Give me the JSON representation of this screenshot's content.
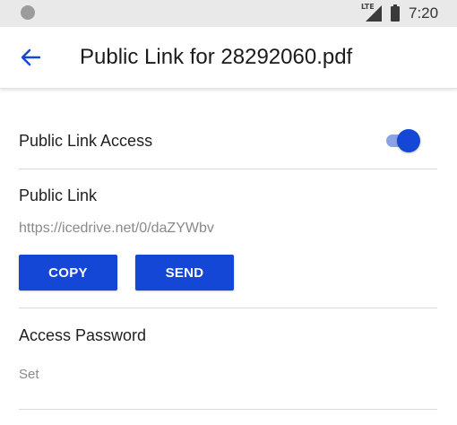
{
  "status_bar": {
    "network": "LTE",
    "time": "7:20"
  },
  "app_bar": {
    "back_icon": "arrow-left-icon",
    "title": "Public Link for 28292060.pdf"
  },
  "public_link_access": {
    "label": "Public Link Access",
    "enabled": true
  },
  "public_link": {
    "label": "Public Link",
    "url": "https://icedrive.net/0/daZYWbv",
    "copy_label": "COPY",
    "send_label": "SEND"
  },
  "access_password": {
    "label": "Access Password",
    "value": "Set"
  },
  "colors": {
    "accent": "#1447d6",
    "toggle_track": "#8aa3e6",
    "muted_text": "#8a8a8a",
    "divider": "#d9d9de"
  }
}
